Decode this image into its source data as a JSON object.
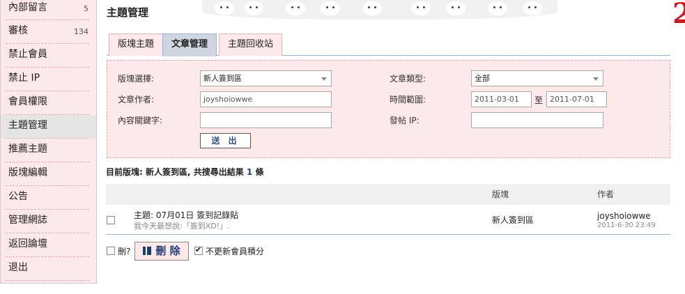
{
  "sidebar": {
    "items": [
      {
        "label": "內部留言",
        "count": "5"
      },
      {
        "label": "審核",
        "count": "134"
      },
      {
        "label": "禁止會員",
        "count": ""
      },
      {
        "label": "禁止 IP",
        "count": ""
      },
      {
        "label": "會員權限",
        "count": ""
      },
      {
        "label": "主題管理",
        "count": ""
      },
      {
        "label": "推薦主題",
        "count": ""
      },
      {
        "label": "版塊編輯",
        "count": ""
      },
      {
        "label": "公告",
        "count": ""
      },
      {
        "label": "管理網誌",
        "count": ""
      },
      {
        "label": "返回論壇",
        "count": ""
      },
      {
        "label": "退出",
        "count": ""
      }
    ],
    "active_index": 5
  },
  "header": {
    "title": "主題管理",
    "logo_text": "2"
  },
  "tabs": [
    "版塊主題",
    "文章管理",
    "主題回收站"
  ],
  "active_tab": 1,
  "search": {
    "board_label": "版塊選擇:",
    "board_value": "新人簽到區",
    "type_label": "文章類型:",
    "type_value": "全部",
    "author_label": "文章作者:",
    "author_value": "joyshoiowwe",
    "time_label": "時間範圍:",
    "time_from": "2011-03-01",
    "time_sep": "至",
    "time_to": "2011-07-01",
    "keyword_label": "內容關鍵字:",
    "keyword_value": "",
    "ip_label": "發帖 IP:",
    "ip_value": "",
    "submit_label": "送 出"
  },
  "summary": {
    "prefix": "目前版塊: 新人簽到區, 共搜尋出結果 ",
    "count": "1",
    "suffix": " 條"
  },
  "table": {
    "headers": {
      "board": "版塊",
      "author": "作者"
    },
    "rows": [
      {
        "title": "主題:  07月01日 簽到記錄貼",
        "excerpt": "我今天最想說:「簽到XD!」.",
        "board": "新人簽到區",
        "author": "joyshoiowwe",
        "date": "2011-6-30 23:49"
      }
    ]
  },
  "actions": {
    "delete_question": "刪?",
    "delete_label": "刪 除",
    "no_points_label": "不更新會員積分",
    "no_points_checked": true
  },
  "colors": {
    "sidebar_bg": "#fde8ea",
    "panel_bg": "#fde8ea",
    "accent_blue": "#1d3c74",
    "active_tab_bg": "#cfd6df",
    "brand_red": "#c81c22"
  }
}
